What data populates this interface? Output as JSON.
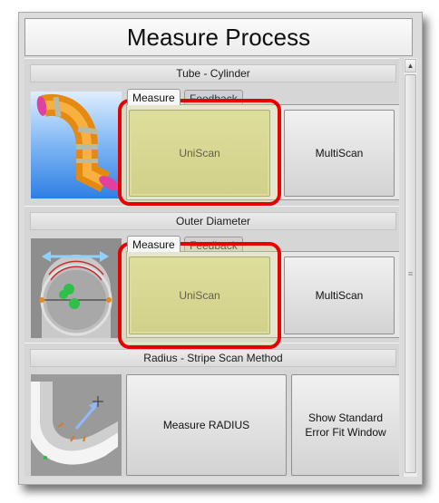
{
  "window": {
    "title": "Measure Process"
  },
  "sections": [
    {
      "header": "Tube - Cylinder",
      "tabs": [
        "Measure",
        "Feedback"
      ],
      "buttons": [
        "UniScan",
        "MultiScan"
      ]
    },
    {
      "header": "Outer Diameter",
      "tabs": [
        "Measure",
        "Feedback"
      ],
      "buttons": [
        "UniScan",
        "MultiScan"
      ]
    },
    {
      "header": "Radius - Stripe Scan Method",
      "buttons": [
        "Measure RADIUS",
        "Show Standard Error Fit Window"
      ]
    }
  ],
  "scrollbar": {
    "up_glyph": "▲",
    "grip_glyph": "≡"
  },
  "colors": {
    "highlight_ring": "#e60000",
    "highlighted_button": "#c9c98a",
    "tube": "#f39a1a",
    "tube_end_cap": "#e040a0"
  }
}
